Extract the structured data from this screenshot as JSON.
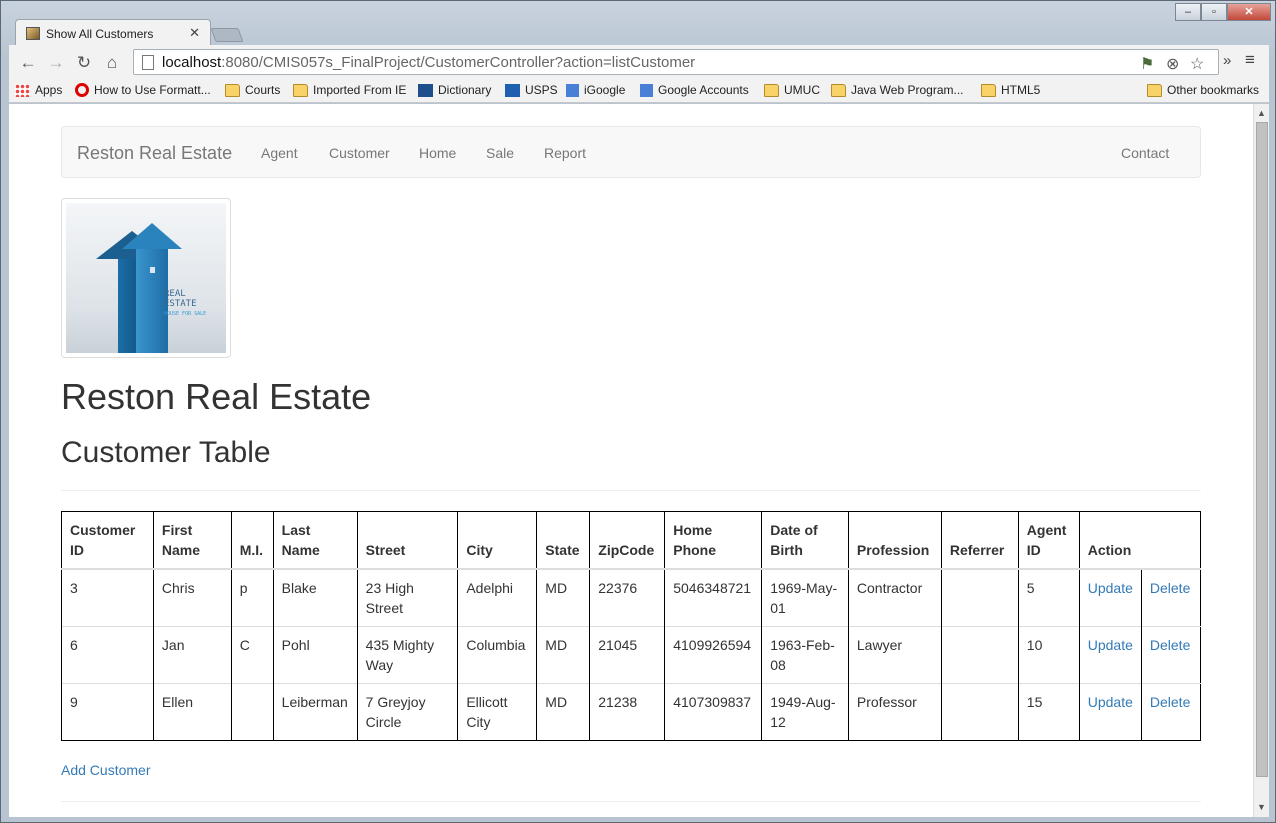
{
  "browser": {
    "tab_title": "Show All Customers",
    "url_host": "localhost",
    "url_rest": ":8080/CMIS057s_FinalProject/CustomerController?action=listCustomer",
    "bookmarks": [
      {
        "label": "Apps",
        "icon": "apps-icon"
      },
      {
        "label": "How to Use Formatt...",
        "icon": "opera-icon"
      },
      {
        "label": "Courts",
        "icon": "folder-icon"
      },
      {
        "label": "Imported From IE",
        "icon": "folder-icon"
      },
      {
        "label": "Dictionary",
        "icon": "dictionary-icon"
      },
      {
        "label": "USPS",
        "icon": "usps-icon"
      },
      {
        "label": "iGoogle",
        "icon": "google-icon"
      },
      {
        "label": "Google Accounts",
        "icon": "google-icon"
      },
      {
        "label": "UMUC",
        "icon": "folder-icon"
      },
      {
        "label": "Java Web Program...",
        "icon": "folder-icon"
      },
      {
        "label": "HTML5",
        "icon": "folder-icon"
      }
    ],
    "other_bookmarks": "Other bookmarks"
  },
  "nav": {
    "brand": "Reston Real Estate",
    "links": [
      "Agent",
      "Customer",
      "Home",
      "Sale",
      "Report"
    ],
    "contact": "Contact"
  },
  "logo": {
    "line1": "REAL",
    "line2": "ESTATE",
    "line3": "HOUSE FOR SALE"
  },
  "page": {
    "heading": "Reston Real Estate",
    "subheading": "Customer Table",
    "add_link": "Add Customer"
  },
  "table": {
    "headers": [
      "Customer ID",
      "First Name",
      "M.I.",
      "Last Name",
      "Street",
      "City",
      "State",
      "ZipCode",
      "Home Phone",
      "Date of Birth",
      "Profession",
      "Referrer",
      "Agent ID",
      "Action"
    ],
    "rows": [
      {
        "id": "3",
        "first": "Chris",
        "mi": "p",
        "last": "Blake",
        "street": "23 High Street",
        "city": "Adelphi",
        "state": "MD",
        "zip": "22376",
        "phone": "5046348721",
        "dob": "1969-May-01",
        "profession": "Contractor",
        "referrer": "",
        "agent": "5",
        "update": "Update",
        "delete": "Delete"
      },
      {
        "id": "6",
        "first": "Jan",
        "mi": "C",
        "last": "Pohl",
        "street": "435 Mighty Way",
        "city": "Columbia",
        "state": "MD",
        "zip": "21045",
        "phone": "4109926594",
        "dob": "1963-Feb-08",
        "profession": "Lawyer",
        "referrer": "",
        "agent": "10",
        "update": "Update",
        "delete": "Delete"
      },
      {
        "id": "9",
        "first": "Ellen",
        "mi": "",
        "last": "Leiberman",
        "street": "7 Greyjoy Circle",
        "city": "Ellicott City",
        "state": "MD",
        "zip": "21238",
        "phone": "4107309837",
        "dob": "1949-Aug-12",
        "profession": "Professor",
        "referrer": "",
        "agent": "15",
        "update": "Update",
        "delete": "Delete"
      }
    ]
  },
  "colors": {
    "link": "#337ab7",
    "navbar_bg": "#f8f8f8",
    "nav_text": "#777777"
  }
}
